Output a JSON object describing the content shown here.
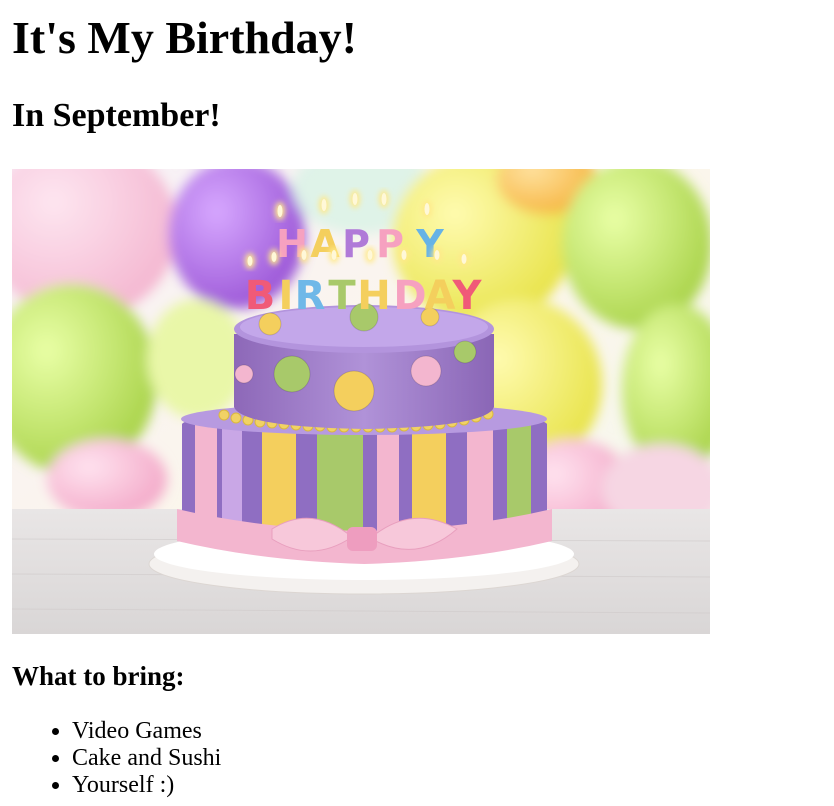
{
  "page": {
    "title": "It's My Birthday!",
    "subtitle": "In September!",
    "image": {
      "icon": "birthday-cake-photo",
      "candle_letters_top": [
        "H",
        "A",
        "P",
        "P",
        "Y"
      ],
      "candle_letters_bottom": [
        "B",
        "I",
        "R",
        "T",
        "H",
        "D",
        "A",
        "Y"
      ],
      "colors": {
        "upper_tier": "#a27cc6",
        "lower_tier": "#8f6ec2",
        "ribbon": "#f3b6cf",
        "accent_yellow": "#f4cf5d",
        "accent_green": "#a8c96a"
      }
    },
    "bring_heading": "What to bring:",
    "bring_items": [
      "Video Games",
      "Cake and Sushi",
      "Yourself :)"
    ]
  }
}
